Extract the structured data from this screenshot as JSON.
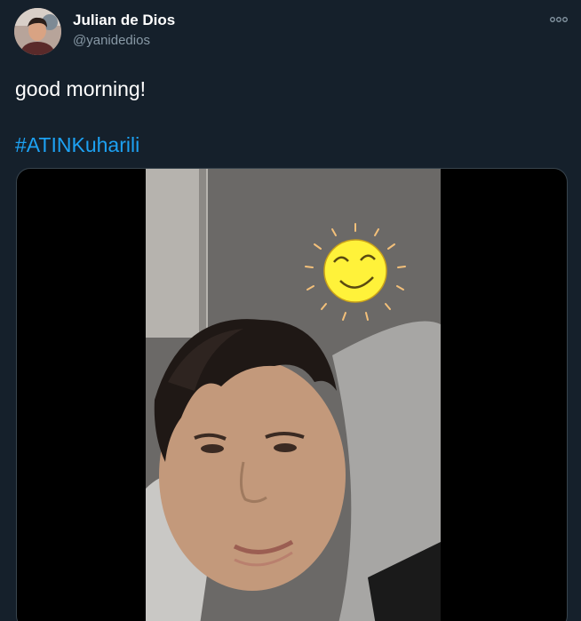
{
  "author": {
    "display_name": "Julian de Dios",
    "handle": "@yanidedios",
    "avatar_icon": "profile-photo-icon"
  },
  "menu": {
    "more_icon": "more-options-icon"
  },
  "tweet": {
    "text": "good morning!",
    "hashtag": "#ATINKuharili"
  },
  "media": {
    "type": "video",
    "icon": "sun-sticker-icon"
  },
  "colors": {
    "background": "#15202b",
    "name": "#ffffff",
    "handle": "#8899a6",
    "link": "#1da1f2"
  }
}
